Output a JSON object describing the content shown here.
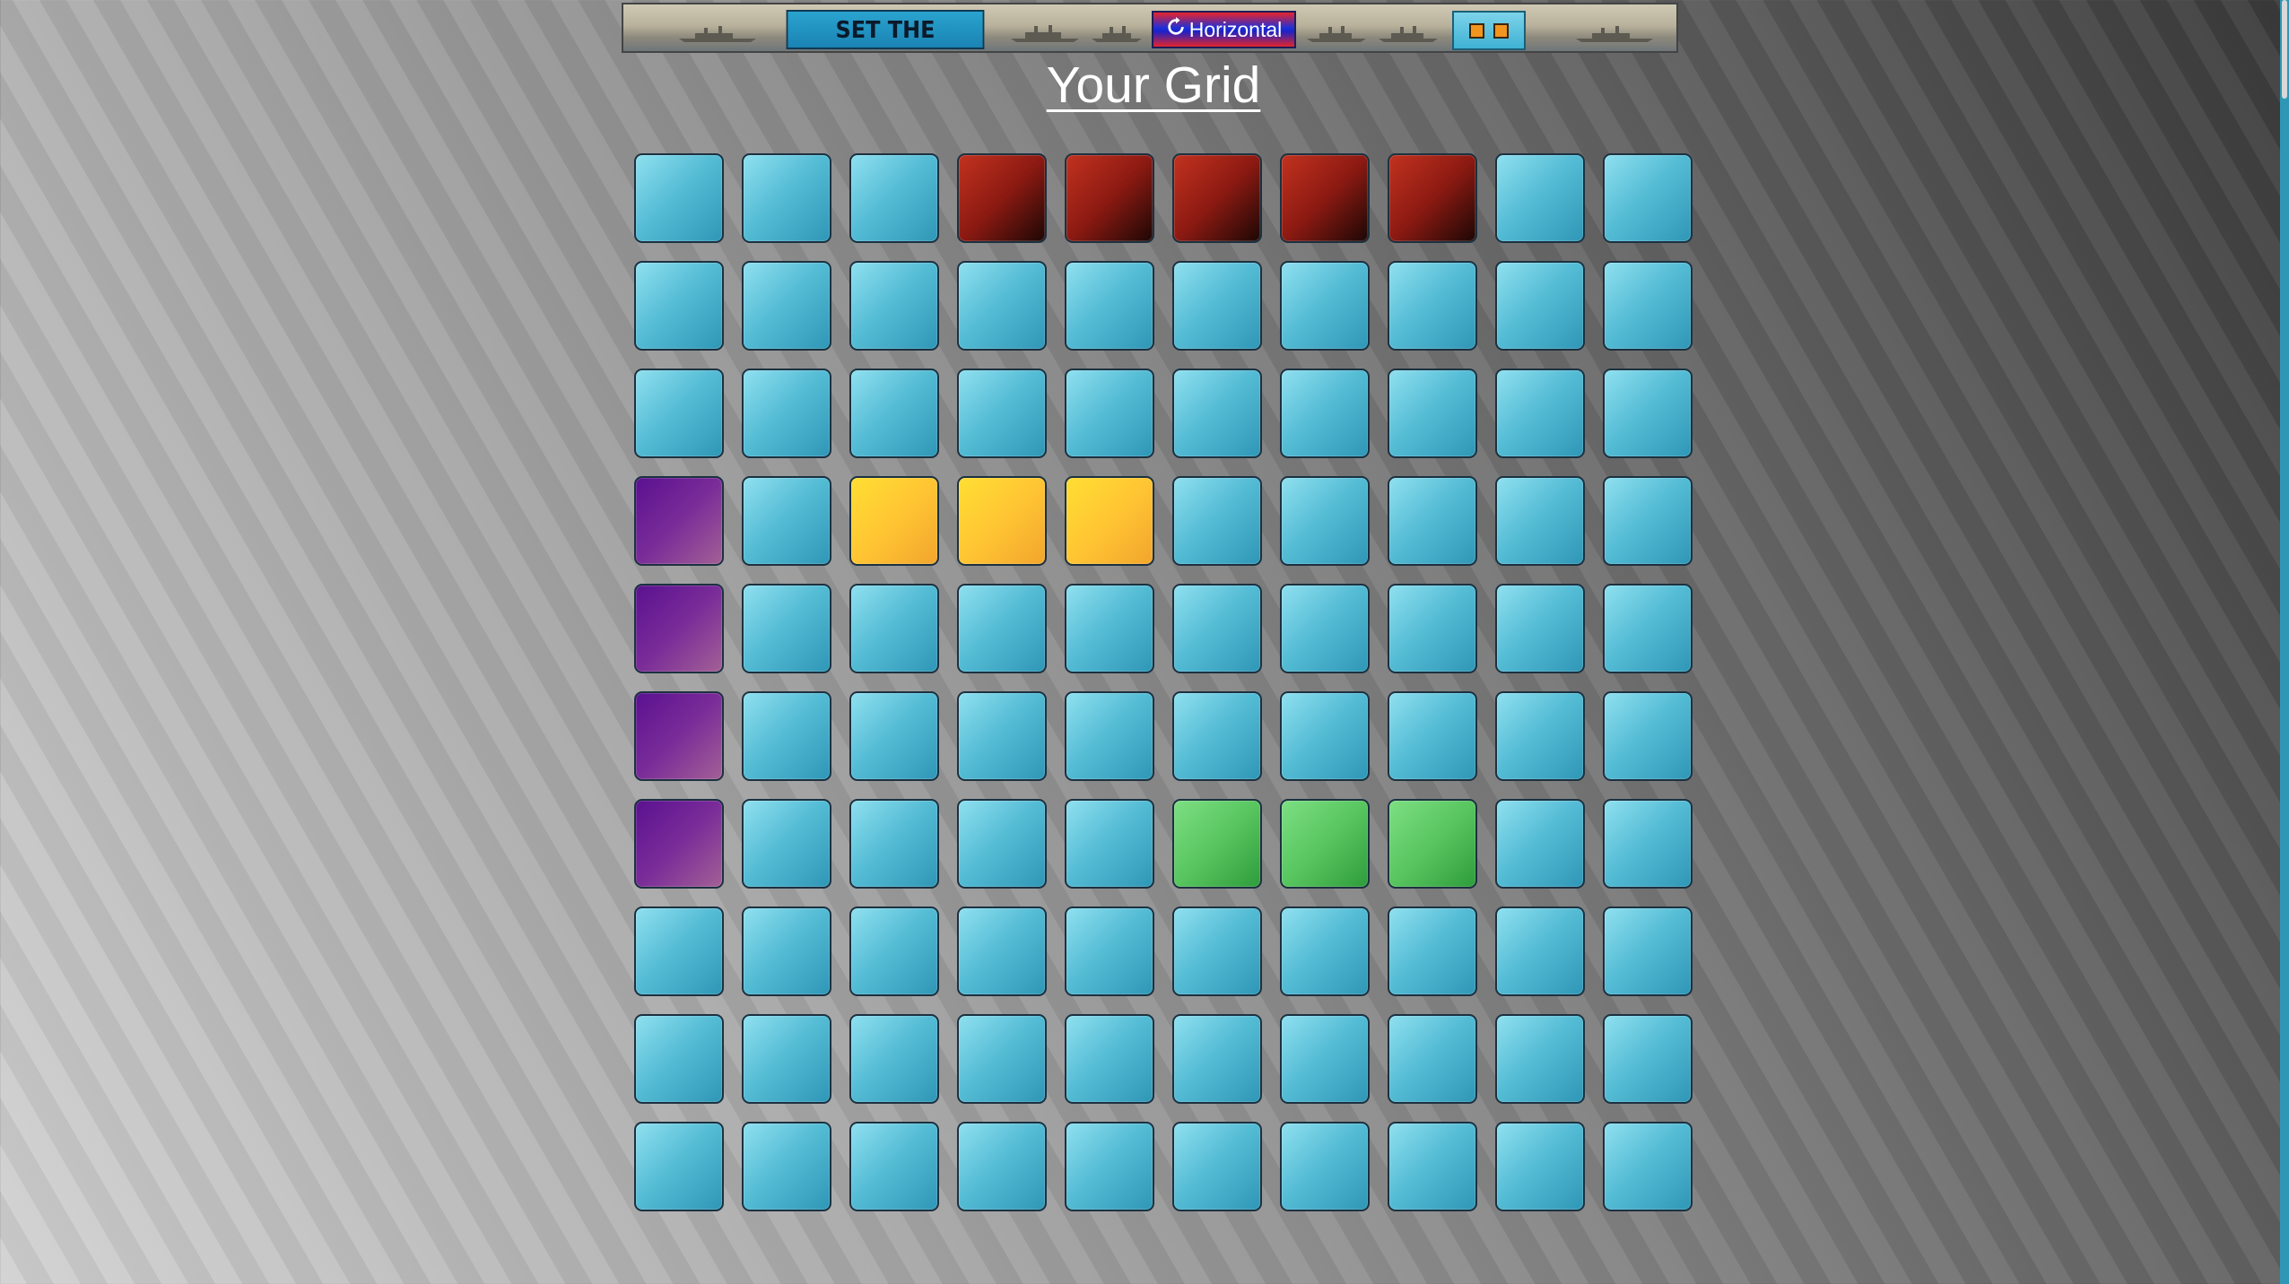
{
  "banner": {
    "set_button_label": "SET THE DESTROYER",
    "orientation_label": "Horizontal",
    "orientation_icon": "refresh-icon",
    "preview_cells": 2,
    "preview_color": "#f2951f"
  },
  "title": "Your Grid",
  "grid": {
    "rows": 10,
    "cols": 10,
    "cells": [
      [
        "water",
        "water",
        "water",
        "destroyer",
        "destroyer",
        "destroyer",
        "destroyer",
        "destroyer",
        "water",
        "water"
      ],
      [
        "water",
        "water",
        "water",
        "water",
        "water",
        "water",
        "water",
        "water",
        "water",
        "water"
      ],
      [
        "water",
        "water",
        "water",
        "water",
        "water",
        "water",
        "water",
        "water",
        "water",
        "water"
      ],
      [
        "battleship",
        "water",
        "submarine",
        "submarine",
        "submarine",
        "water",
        "water",
        "water",
        "water",
        "water"
      ],
      [
        "battleship",
        "water",
        "water",
        "water",
        "water",
        "water",
        "water",
        "water",
        "water",
        "water"
      ],
      [
        "battleship",
        "water",
        "water",
        "water",
        "water",
        "water",
        "water",
        "water",
        "water",
        "water"
      ],
      [
        "battleship",
        "water",
        "water",
        "water",
        "water",
        "cruiser",
        "cruiser",
        "cruiser",
        "water",
        "water"
      ],
      [
        "water",
        "water",
        "water",
        "water",
        "water",
        "water",
        "water",
        "water",
        "water",
        "water"
      ],
      [
        "water",
        "water",
        "water",
        "water",
        "water",
        "water",
        "water",
        "water",
        "water",
        "water"
      ],
      [
        "water",
        "water",
        "water",
        "water",
        "water",
        "water",
        "water",
        "water",
        "water",
        "water"
      ]
    ],
    "colors": {
      "water": "#56bdd6",
      "destroyer": "#8c1a12",
      "battleship": "#7a2c98",
      "submarine": "#ffc533",
      "cruiser": "#58c55f"
    }
  }
}
